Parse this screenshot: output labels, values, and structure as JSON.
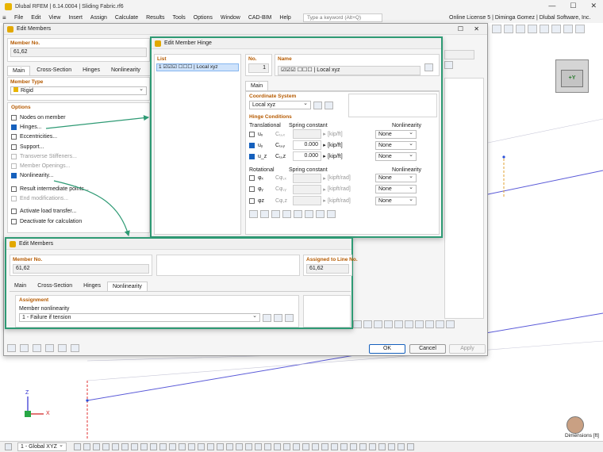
{
  "app": {
    "title": "Dlubal RFEM | 6.14.0004 | Sliding Fabric.rf6",
    "window_controls": [
      "—",
      "☐",
      "✕"
    ],
    "menu": [
      "File",
      "Edit",
      "View",
      "Insert",
      "Assign",
      "Calculate",
      "Results",
      "Tools",
      "Options",
      "Window",
      "CAD-BIM",
      "Help"
    ],
    "search_placeholder": "Type a keyword (Alt+Q)",
    "license": "Online License 5 | Diminga Gomez | Dlubal Software, Inc.",
    "viewcube_label": "+Y",
    "axes": {
      "z": "Z",
      "x": "X"
    },
    "dimensions_label": "Dimensions [ft]",
    "statusbar_view": "1 - Global XYZ"
  },
  "edit_members": {
    "title": "Edit Members",
    "member_no_label": "Member No.",
    "member_no_value": "61,62",
    "tabs": [
      "Main",
      "Cross-Section",
      "Hinges",
      "Nonlinearity"
    ],
    "member_type_label": "Member Type",
    "member_type_value": "Rigid",
    "options_label": "Options",
    "options": [
      {
        "label": "Nodes on member",
        "checked": false,
        "disabled": false
      },
      {
        "label": "Hinges...",
        "checked": true,
        "disabled": false
      },
      {
        "label": "Eccentricities...",
        "checked": false,
        "disabled": false
      },
      {
        "label": "Support...",
        "checked": false,
        "disabled": false
      },
      {
        "label": "Transverse Stiffeners...",
        "checked": false,
        "disabled": true
      },
      {
        "label": "Member Openings...",
        "checked": false,
        "disabled": true
      },
      {
        "label": "Nonlinearity...",
        "checked": true,
        "disabled": false
      },
      {
        "label": "Result intermediate points...",
        "checked": false,
        "disabled": false
      },
      {
        "label": "End modifications...",
        "checked": false,
        "disabled": true
      },
      {
        "label": "Activate load transfer...",
        "checked": false,
        "disabled": false
      },
      {
        "label": "Deactivate for calculation",
        "checked": false,
        "disabled": false
      }
    ],
    "buttons": {
      "ok": "OK",
      "cancel": "Cancel",
      "apply": "Apply"
    }
  },
  "edit_member_hinge": {
    "title": "Edit Member Hinge",
    "list_label": "List",
    "list_item": "1 ☑☑☑ ☐☐☐ | Local xyz",
    "no_label": "No.",
    "no_value": "1",
    "name_label": "Name",
    "name_value": "☑☑☑ ☐☐☐ | Local xyz",
    "tab": "Main",
    "coord_label": "Coordinate System",
    "coord_value": "Local xyz",
    "hinge_conditions_label": "Hinge Conditions",
    "translational_label": "Translational",
    "rotational_label": "Rotational",
    "spring_constant_label": "Spring constant",
    "nonlinearity_label": "Nonlinearity",
    "translational": [
      {
        "dof": "uₓ",
        "const": "Cᵤ,ₓ",
        "checked": false,
        "value": "",
        "unit": "[kip/ft]",
        "nonlin": "None"
      },
      {
        "dof": "uᵧ",
        "const": "Cᵤ,ᵧ",
        "checked": true,
        "value": "0.000",
        "unit": "[kip/ft]",
        "nonlin": "None"
      },
      {
        "dof": "u_z",
        "const": "Cᵤ,z",
        "checked": true,
        "value": "0.000",
        "unit": "[kip/ft]",
        "nonlin": "None"
      }
    ],
    "rotational": [
      {
        "dof": "φₓ",
        "const": "Cφ,ₓ",
        "checked": false,
        "unit": "[kipft/rad]",
        "nonlin": "None"
      },
      {
        "dof": "φᵧ",
        "const": "Cφ,ᵧ",
        "checked": false,
        "unit": "[kipft/rad]",
        "nonlin": "None"
      },
      {
        "dof": "φz",
        "const": "Cφ,z",
        "checked": false,
        "unit": "[kipft/rad]",
        "nonlin": "None"
      }
    ]
  },
  "edit_members_2": {
    "title": "Edit Members",
    "member_no_label": "Member No.",
    "member_no_value": "61,62",
    "assigned_label": "Assigned to Line No.",
    "assigned_value": "61,62",
    "tabs": [
      "Main",
      "Cross-Section",
      "Hinges",
      "Nonlinearity"
    ],
    "assignment_label": "Assignment",
    "member_nonlinearity_label": "Member nonlinearity",
    "member_nonlinearity_value": "1 - Failure if tension"
  },
  "colors": {
    "accent": "#2e9a74",
    "check": "#1560bd",
    "group": "#b55a00"
  }
}
